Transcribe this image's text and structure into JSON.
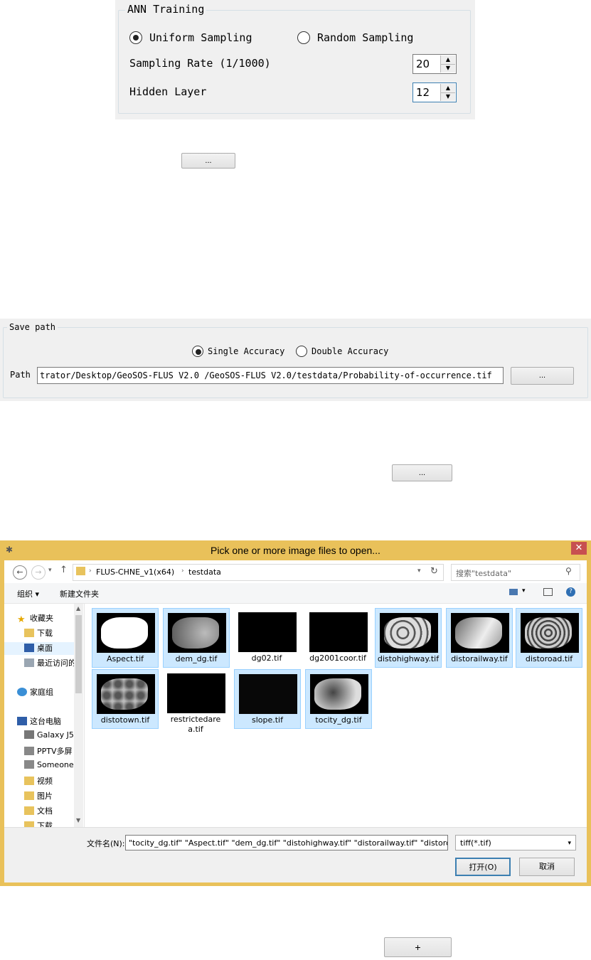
{
  "ann": {
    "group_title": "ANN Training",
    "uniform_label": "Uniform Sampling",
    "random_label": "Random Sampling",
    "rate_label": "Sampling Rate (1/1000)",
    "rate_value": "20",
    "hidden_label": "Hidden Layer",
    "hidden_value": "12"
  },
  "browse_button_1": "...",
  "save": {
    "group_title": "Save path",
    "single_label": "Single Accuracy",
    "double_label": "Double Accuracy",
    "path_label": "Path",
    "path_value": "trator/Desktop/GeoSOS-FLUS V2.0 /GeoSOS-FLUS V2.0/testdata/Probability-of-occurrence.tif",
    "browse_label": "..."
  },
  "browse_button_2": "...",
  "dialog": {
    "title": "Pick one or more image files to open...",
    "close": "✕",
    "breadcrumb": [
      "FLUS-CHNE_v1(x64)",
      "testdata"
    ],
    "search_placeholder": "搜索\"testdata\"",
    "organize": "组织 ▾",
    "new_folder": "新建文件夹",
    "sidebar": [
      {
        "label": "收藏夹",
        "icon": "star-icon"
      },
      {
        "label": "下载",
        "icon": "download-folder-icon"
      },
      {
        "label": "桌面",
        "icon": "desktop-icon"
      },
      {
        "label": "最近访问的",
        "icon": "recent-icon"
      },
      {
        "label": "家庭组",
        "icon": "homegroup-icon"
      },
      {
        "label": "这台电脑",
        "icon": "computer-icon"
      },
      {
        "label": "Galaxy J5",
        "icon": "phone-icon"
      },
      {
        "label": "PPTV多屏",
        "icon": "media-device-icon"
      },
      {
        "label": "Someone",
        "icon": "media-device-icon"
      },
      {
        "label": "视频",
        "icon": "folder-icon"
      },
      {
        "label": "图片",
        "icon": "folder-icon"
      },
      {
        "label": "文档",
        "icon": "folder-icon"
      },
      {
        "label": "下载",
        "icon": "folder-icon"
      }
    ],
    "files": [
      {
        "name": "Aspect.tif",
        "selected": true
      },
      {
        "name": "dem_dg.tif",
        "selected": true
      },
      {
        "name": "dg02.tif",
        "selected": false
      },
      {
        "name": "dg2001coor.tif",
        "selected": false
      },
      {
        "name": "distohighway.tif",
        "selected": true
      },
      {
        "name": "distorailway.tif",
        "selected": true
      },
      {
        "name": "distoroad.tif",
        "selected": true
      },
      {
        "name": "distotown.tif",
        "selected": true
      },
      {
        "name": "restrictedarea.tif",
        "selected": false
      },
      {
        "name": "slope.tif",
        "selected": true
      },
      {
        "name": "tocity_dg.tif",
        "selected": true
      }
    ],
    "filename_label": "文件名(N):",
    "filename_value": "\"tocity_dg.tif\" \"Aspect.tif\" \"dem_dg.tif\" \"distohighway.tif\" \"distorailway.tif\" \"distoroa",
    "filter_value": "tiff(*.tif)",
    "open_button": "打开(O)",
    "cancel_button": "取消"
  },
  "add_button": "+"
}
